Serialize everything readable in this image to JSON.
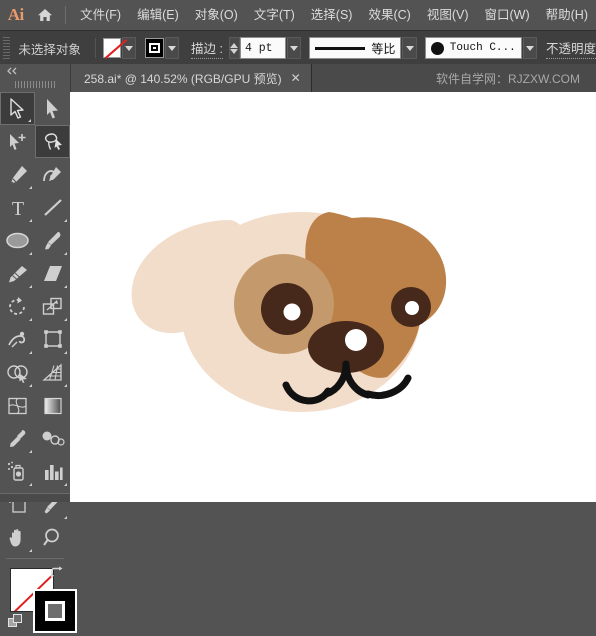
{
  "app": {
    "name": "Ai",
    "logo_text": "Ai",
    "home_icon": "home-icon"
  },
  "menubar": {
    "items": [
      {
        "label": "文件(F)",
        "name": "menu-file"
      },
      {
        "label": "编辑(E)",
        "name": "menu-edit"
      },
      {
        "label": "对象(O)",
        "name": "menu-object"
      },
      {
        "label": "文字(T)",
        "name": "menu-type"
      },
      {
        "label": "选择(S)",
        "name": "menu-select"
      },
      {
        "label": "效果(C)",
        "name": "menu-effect"
      },
      {
        "label": "视图(V)",
        "name": "menu-view"
      },
      {
        "label": "窗口(W)",
        "name": "menu-window"
      },
      {
        "label": "帮助(H)",
        "name": "menu-help"
      }
    ]
  },
  "controlbar": {
    "selection_status": "未选择对象",
    "fill_swatch": "none",
    "stroke_swatch": "black",
    "stroke_label": "描边 :",
    "stroke_weight": "4 pt",
    "stroke_profile": "等比",
    "brush_definition": "Touch C...",
    "opacity_label": "不透明度"
  },
  "tabstrip": {
    "document_tab": "258.ai* @ 140.52% (RGB/GPU 预览)",
    "close_glyph": "✕",
    "watermark": "软件自学网：RJZXW.COM"
  },
  "toolbar": {
    "collapse_glyph": "◀◀",
    "tools": [
      {
        "name": "selection-tool",
        "label": "选择工具",
        "selected": true,
        "corner": true
      },
      {
        "name": "direct-selection-tool",
        "label": "直接选择工具",
        "selected": false,
        "corner": false
      },
      {
        "name": "magic-wand-tool",
        "label": "魔棒工具",
        "selected": false,
        "corner": false
      },
      {
        "name": "lasso-tool",
        "label": "套索工具",
        "selected": true,
        "corner": false
      },
      {
        "name": "pen-tool",
        "label": "钢笔工具",
        "selected": false,
        "corner": true
      },
      {
        "name": "curvature-tool",
        "label": "曲率工具",
        "selected": false,
        "corner": false
      },
      {
        "name": "type-tool",
        "label": "文字工具",
        "selected": false,
        "corner": true
      },
      {
        "name": "line-segment-tool",
        "label": "直线段工具",
        "selected": false,
        "corner": true
      },
      {
        "name": "ellipse-tool",
        "label": "椭圆工具",
        "selected": false,
        "corner": true
      },
      {
        "name": "paintbrush-tool",
        "label": "画笔工具",
        "selected": false,
        "corner": true
      },
      {
        "name": "shaper-tool",
        "label": "Shaper 工具",
        "selected": false,
        "corner": true
      },
      {
        "name": "eraser-tool",
        "label": "橡皮擦工具",
        "selected": false,
        "corner": true
      },
      {
        "name": "rotate-tool",
        "label": "旋转工具",
        "selected": false,
        "corner": true
      },
      {
        "name": "scale-tool",
        "label": "比例缩放工具",
        "selected": false,
        "corner": true
      },
      {
        "name": "width-tool",
        "label": "宽度工具",
        "selected": false,
        "corner": true
      },
      {
        "name": "free-transform-tool",
        "label": "自由变换工具",
        "selected": false,
        "corner": true
      },
      {
        "name": "shape-builder-tool",
        "label": "形状生成器工具",
        "selected": false,
        "corner": true
      },
      {
        "name": "perspective-grid-tool",
        "label": "透视网格工具",
        "selected": false,
        "corner": true
      },
      {
        "name": "mesh-tool",
        "label": "网格工具",
        "selected": false,
        "corner": false
      },
      {
        "name": "gradient-tool",
        "label": "渐变工具",
        "selected": false,
        "corner": false
      },
      {
        "name": "eyedropper-tool",
        "label": "吸管工具",
        "selected": false,
        "corner": true
      },
      {
        "name": "blend-tool",
        "label": "混合工具",
        "selected": false,
        "corner": false
      },
      {
        "name": "symbol-sprayer-tool",
        "label": "符号喷枪工具",
        "selected": false,
        "corner": true
      },
      {
        "name": "column-graph-tool",
        "label": "柱形图工具",
        "selected": false,
        "corner": true
      },
      {
        "name": "artboard-tool",
        "label": "画板工具",
        "selected": false,
        "corner": false
      },
      {
        "name": "slice-tool",
        "label": "切片工具",
        "selected": false,
        "corner": true
      },
      {
        "name": "hand-tool",
        "label": "抓手工具",
        "selected": false,
        "corner": true
      },
      {
        "name": "zoom-tool",
        "label": "缩放工具",
        "selected": false,
        "corner": false
      }
    ],
    "fill_stroke": {
      "fill": "none",
      "stroke": "black",
      "swap_icon": "swap-fill-stroke-icon",
      "default_icon": "default-fill-stroke-icon"
    }
  },
  "artwork": {
    "title": "卡通小狗头像",
    "colors": {
      "face_light": "#F2DDCB",
      "patch_brown": "#BC8049",
      "eye_patch": "#C49A6C",
      "dark_brown": "#46291A",
      "nose": "#46291A",
      "mouth": "#111111",
      "highlight": "#FFFFFF",
      "background": "#FFFFFF"
    },
    "parts": [
      {
        "name": "left-ear",
        "color": "#F2DDCB"
      },
      {
        "name": "right-ear",
        "color": "#BC8049"
      },
      {
        "name": "head-light",
        "color": "#F2DDCB"
      },
      {
        "name": "head-patch",
        "color": "#BC8049"
      },
      {
        "name": "left-eye-patch",
        "color": "#C49A6C"
      },
      {
        "name": "left-eye",
        "color": "#46291A"
      },
      {
        "name": "right-eye",
        "color": "#46291A"
      },
      {
        "name": "nose",
        "color": "#46291A"
      },
      {
        "name": "mouth",
        "color": "#111111"
      }
    ]
  }
}
